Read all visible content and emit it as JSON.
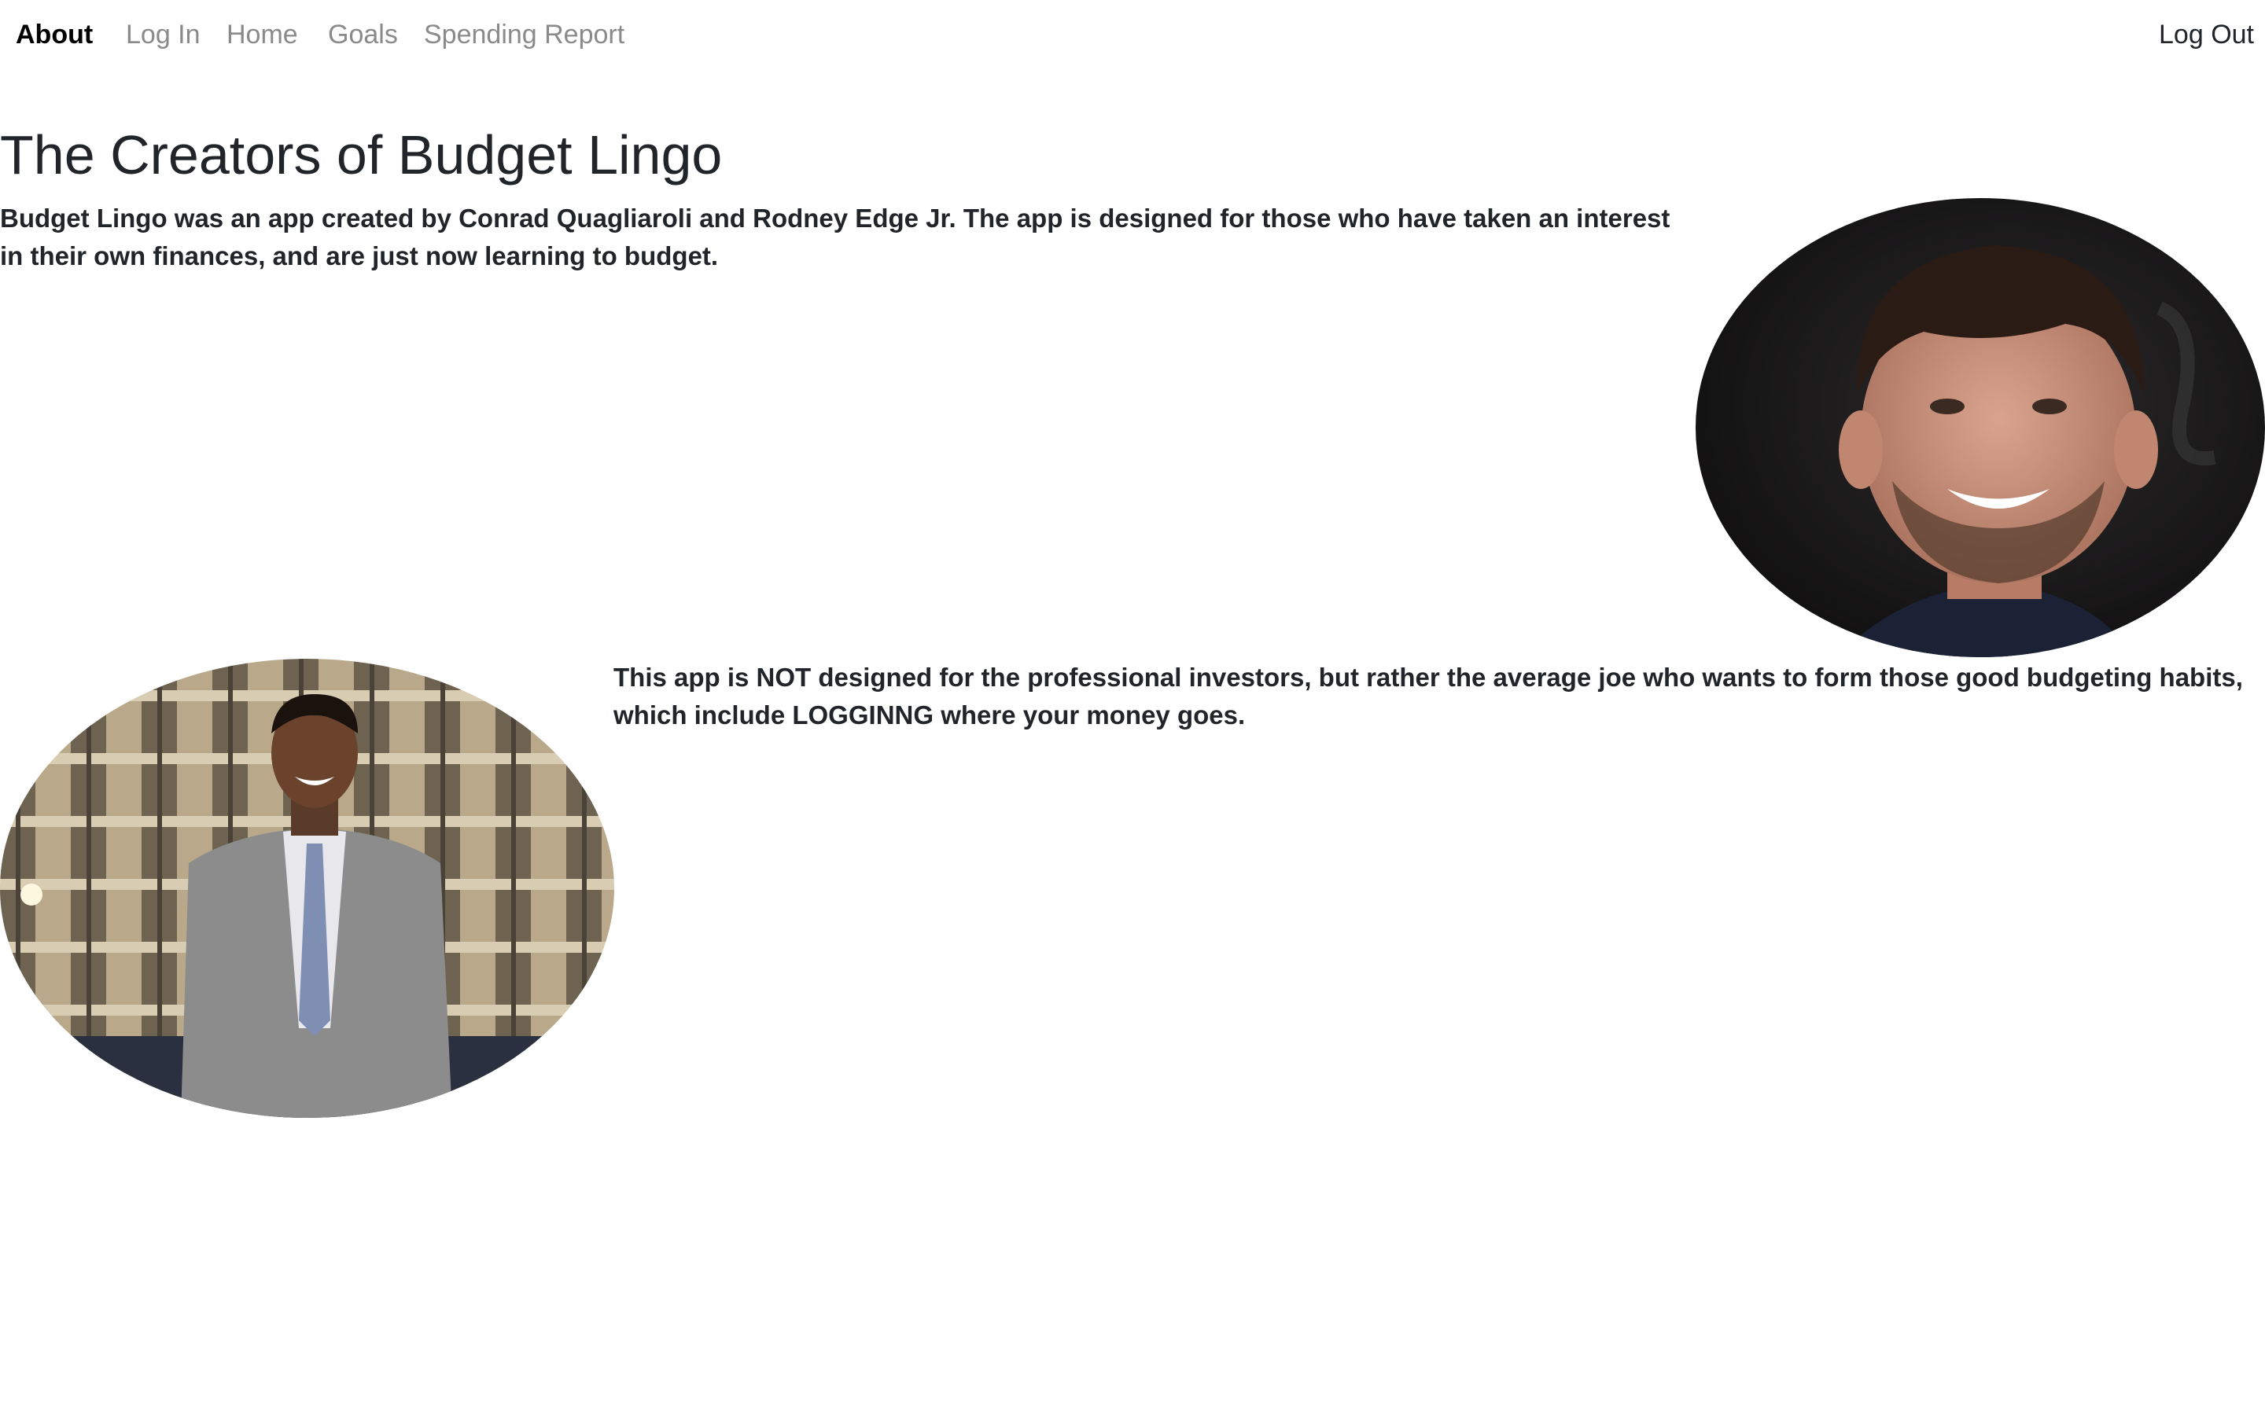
{
  "nav": {
    "items": [
      {
        "label": "About",
        "active": true
      },
      {
        "label": "Log In",
        "active": false
      },
      {
        "label": "Home",
        "active": false
      },
      {
        "label": "Goals",
        "active": false
      },
      {
        "label": "Spending Report",
        "active": false
      }
    ],
    "logout_label": "Log Out"
  },
  "main": {
    "title": "The Creators of Budget Lingo",
    "intro": "Budget Lingo was an app created by Conrad Quagliaroli and Rodney Edge Jr. The app is designed for those who have taken an interest in their own finances, and are just now learning to budget.",
    "audience": "This app is NOT designed for the professional investors, but rather the average joe who wants to form those good budgeting habits, which include LOGGINNG where your money goes."
  },
  "photos": {
    "conrad": {
      "icon": "portrait-photo"
    },
    "rodney": {
      "icon": "portrait-photo"
    }
  },
  "colors": {
    "text": "#212529",
    "nav_inactive": "#8a8a8a",
    "nav_active": "#000000",
    "background": "#ffffff"
  }
}
